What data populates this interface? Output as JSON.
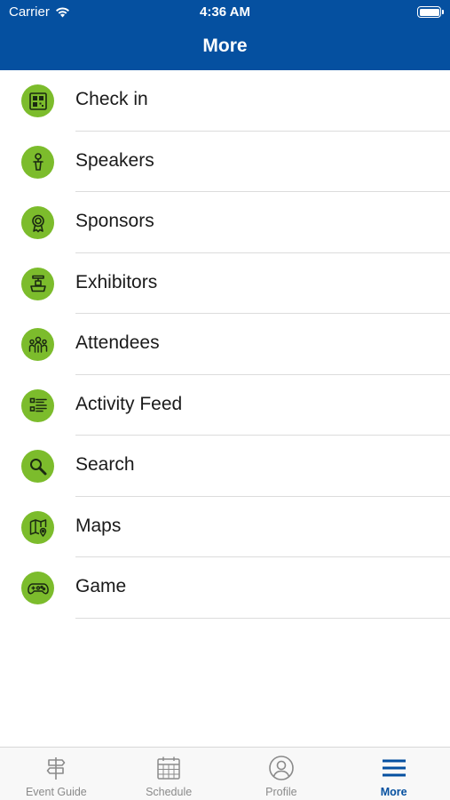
{
  "status_bar": {
    "carrier": "Carrier",
    "time": "4:36 AM"
  },
  "header": {
    "title": "More"
  },
  "colors": {
    "header_bg": "#0550a0",
    "icon_bg": "#7cbc2c",
    "tab_active": "#0550a0",
    "tab_inactive": "#8a8a8a"
  },
  "menu": {
    "items": [
      {
        "label": "Check in",
        "icon": "qr-code-icon"
      },
      {
        "label": "Speakers",
        "icon": "speaker-podium-icon"
      },
      {
        "label": "Sponsors",
        "icon": "award-ribbon-icon"
      },
      {
        "label": "Exhibitors",
        "icon": "exhibit-booth-icon"
      },
      {
        "label": "Attendees",
        "icon": "people-group-icon"
      },
      {
        "label": "Activity Feed",
        "icon": "feed-list-icon"
      },
      {
        "label": "Search",
        "icon": "magnifier-icon"
      },
      {
        "label": "Maps",
        "icon": "map-pin-icon"
      },
      {
        "label": "Game",
        "icon": "gamepad-icon"
      }
    ]
  },
  "tabbar": {
    "tabs": [
      {
        "label": "Event Guide",
        "icon": "signpost-icon",
        "active": false
      },
      {
        "label": "Schedule",
        "icon": "calendar-icon",
        "active": false
      },
      {
        "label": "Profile",
        "icon": "user-circle-icon",
        "active": false
      },
      {
        "label": "More",
        "icon": "hamburger-menu-icon",
        "active": true
      }
    ]
  }
}
